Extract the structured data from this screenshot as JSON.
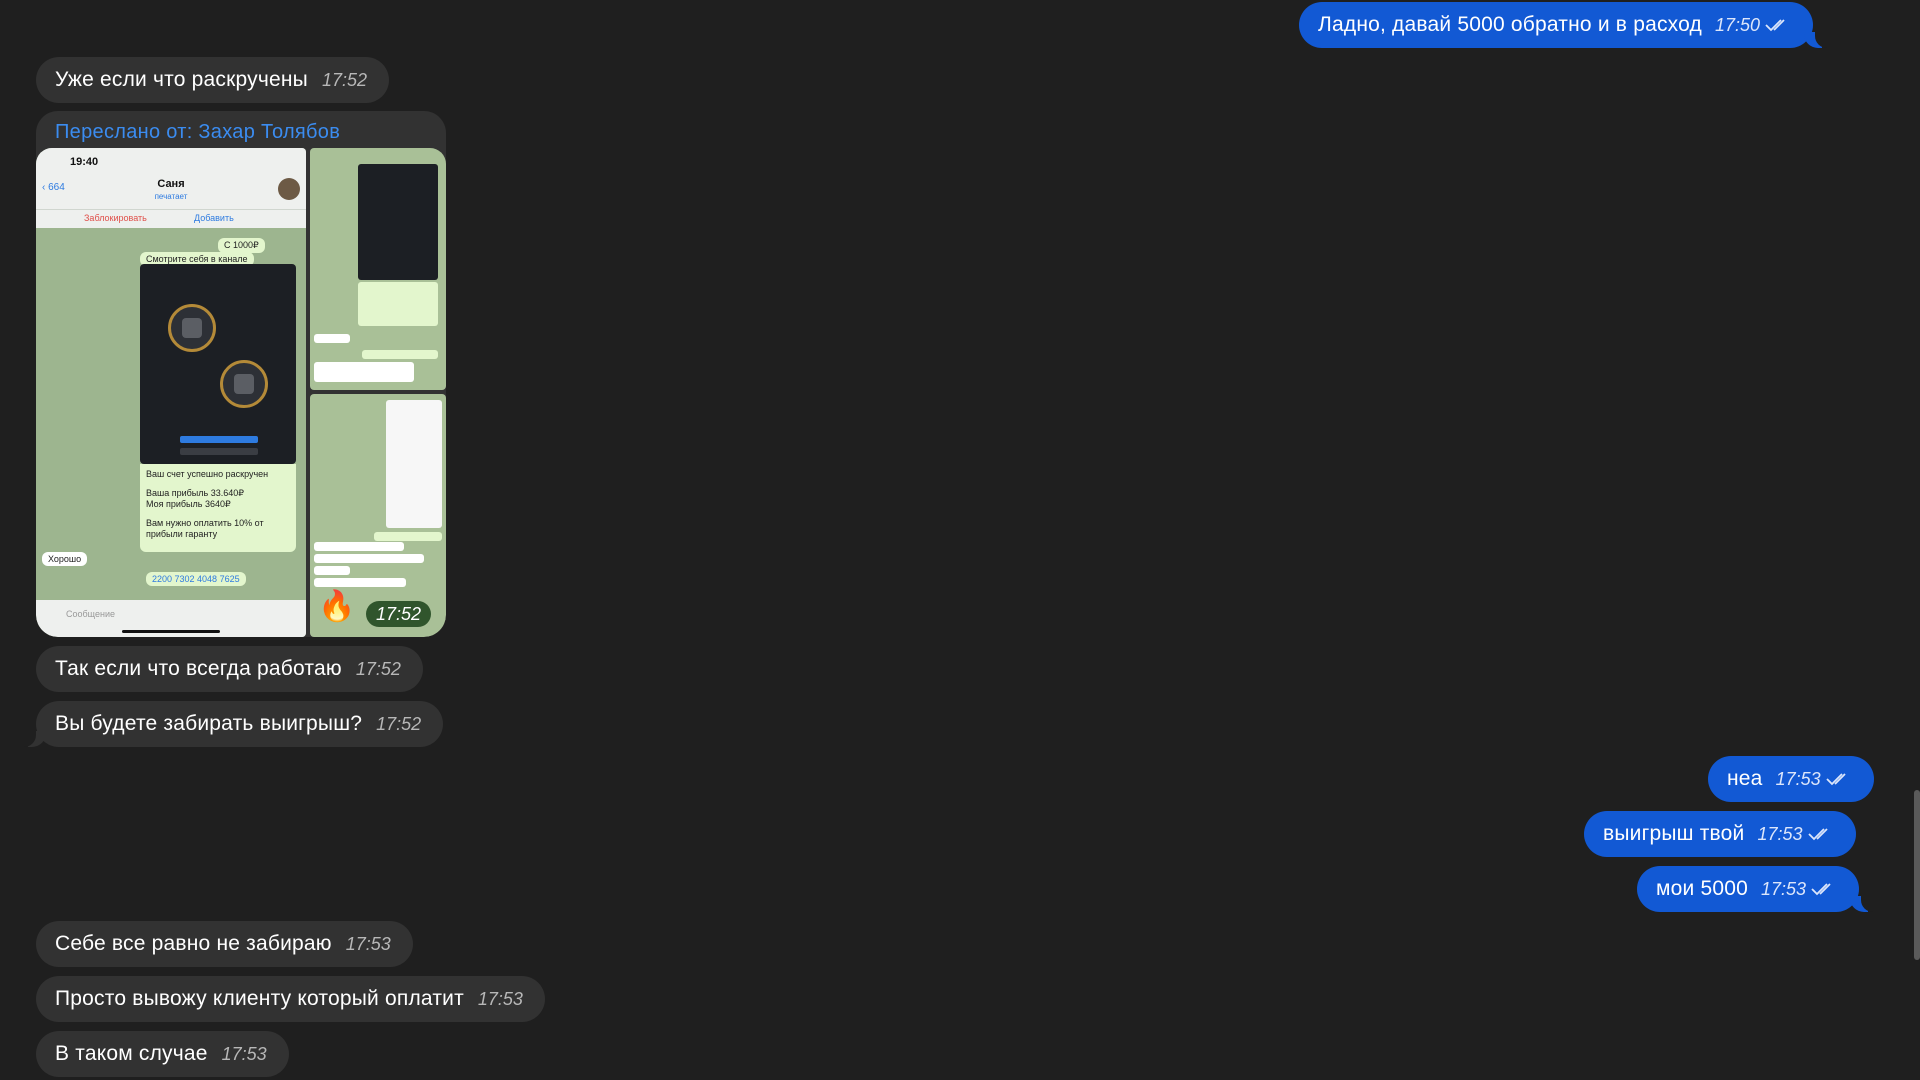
{
  "messages": {
    "m1": {
      "text": "Ладно, давай 5000 обратно и в расход",
      "time": "17:50"
    },
    "m2": {
      "text": "Уже если что раскручены",
      "time": "17:52"
    },
    "m4": {
      "text": "Так если что всегда работаю",
      "time": "17:52"
    },
    "m5": {
      "text": "Вы будете забирать выигрыш?",
      "time": "17:52"
    },
    "m6": {
      "text": "неа",
      "time": "17:53"
    },
    "m7": {
      "text": "выигрыш твой",
      "time": "17:53"
    },
    "m8": {
      "text": "мои 5000",
      "time": "17:53"
    },
    "m9": {
      "text": "Себе все равно не забираю",
      "time": "17:53"
    },
    "m10": {
      "text": "Просто вывожу клиенту который оплатит",
      "time": "17:53"
    },
    "m11": {
      "text": "В таком случае",
      "time": "17:53"
    }
  },
  "forwarded": {
    "header": "Переслано от: Захар Толябов",
    "time": "17:52",
    "screenshot": {
      "status_time": "19:40",
      "back_badge": "664",
      "contact_name": "Саня",
      "contact_status": "печатает",
      "block_label": "Заблокировать",
      "add_label": "Добавить",
      "msg_amount": "С 1000₽",
      "msg_channel": "Смотрите себя в канале",
      "msg_result_1": "Ваш счет успешно раскручен",
      "msg_result_2": "Ваша прибыль 33.640₽",
      "msg_result_3": "Моя прибыль 3640₽",
      "msg_result_4": "Вам нужно оплатить 10% от",
      "msg_result_5": "прибыли гаранту",
      "msg_ok": "Хорошо",
      "msg_card": "2200 7302 4048 7625",
      "input_placeholder": "Сообщение"
    }
  },
  "colors": {
    "background": "#1f1f1f",
    "incoming": "#323232",
    "outgoing": "#1259d4",
    "forward_link": "#3b8cf0"
  },
  "icons": [
    "double-check-icon",
    "fire-emoji"
  ]
}
